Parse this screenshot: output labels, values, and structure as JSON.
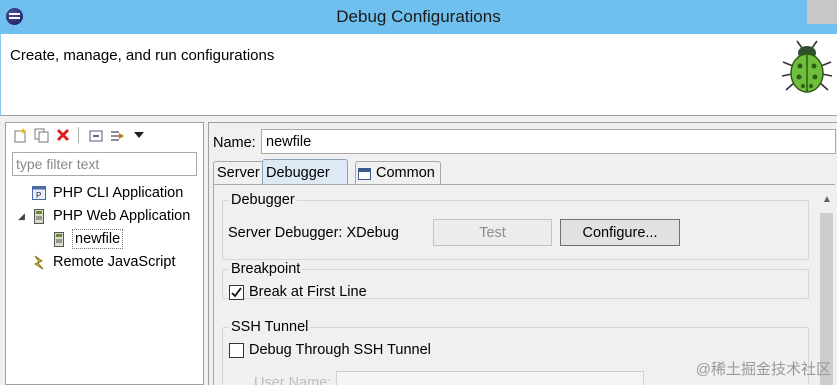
{
  "window": {
    "title": "Debug Configurations"
  },
  "header": {
    "subtitle": "Create, manage, and run configurations"
  },
  "left_panel": {
    "toolbar": [
      {
        "name": "new-config-icon"
      },
      {
        "name": "duplicate-icon"
      },
      {
        "name": "delete-icon"
      },
      {
        "name": "collapse-all-icon"
      },
      {
        "name": "filter-icon"
      },
      {
        "name": "view-menu-icon"
      }
    ],
    "filter": {
      "placeholder": "type filter text",
      "value": ""
    },
    "tree": [
      {
        "label": "PHP CLI Application",
        "icon": "php-cli-icon",
        "level": 0,
        "expanded": false
      },
      {
        "label": "PHP Web Application",
        "icon": "php-web-icon",
        "level": 0,
        "expanded": true
      },
      {
        "label": "newfile",
        "icon": "php-web-icon",
        "level": 1,
        "selected": true
      },
      {
        "label": "Remote JavaScript",
        "icon": "remote-js-icon",
        "level": 0,
        "expanded": false
      }
    ]
  },
  "right_panel": {
    "name_label": "Name:",
    "name_value": "newfile",
    "tabs": [
      {
        "label": "Server",
        "active": false
      },
      {
        "label": "Debugger",
        "active": true
      },
      {
        "label": "Common",
        "active": false,
        "icon": "common-tab-icon"
      }
    ],
    "debugger_group": {
      "title": "Debugger",
      "server_debugger_text": "Server Debugger: XDebug",
      "test_button": "Test",
      "configure_button": "Configure..."
    },
    "breakpoint_group": {
      "title": "Breakpoint",
      "break_first_line_label": "Break at First Line",
      "break_first_line_checked": true
    },
    "ssh_group": {
      "title": "SSH Tunnel",
      "debug_through_ssh_label": "Debug Through SSH Tunnel",
      "debug_through_ssh_checked": false,
      "user_name_label": "User Name:",
      "user_name_value": ""
    }
  },
  "watermark": "@稀土掘金技术社区",
  "colors": {
    "titlebar": "#70c0ef",
    "active_tab": "#dde9f5",
    "delete_red": "#e02020"
  }
}
